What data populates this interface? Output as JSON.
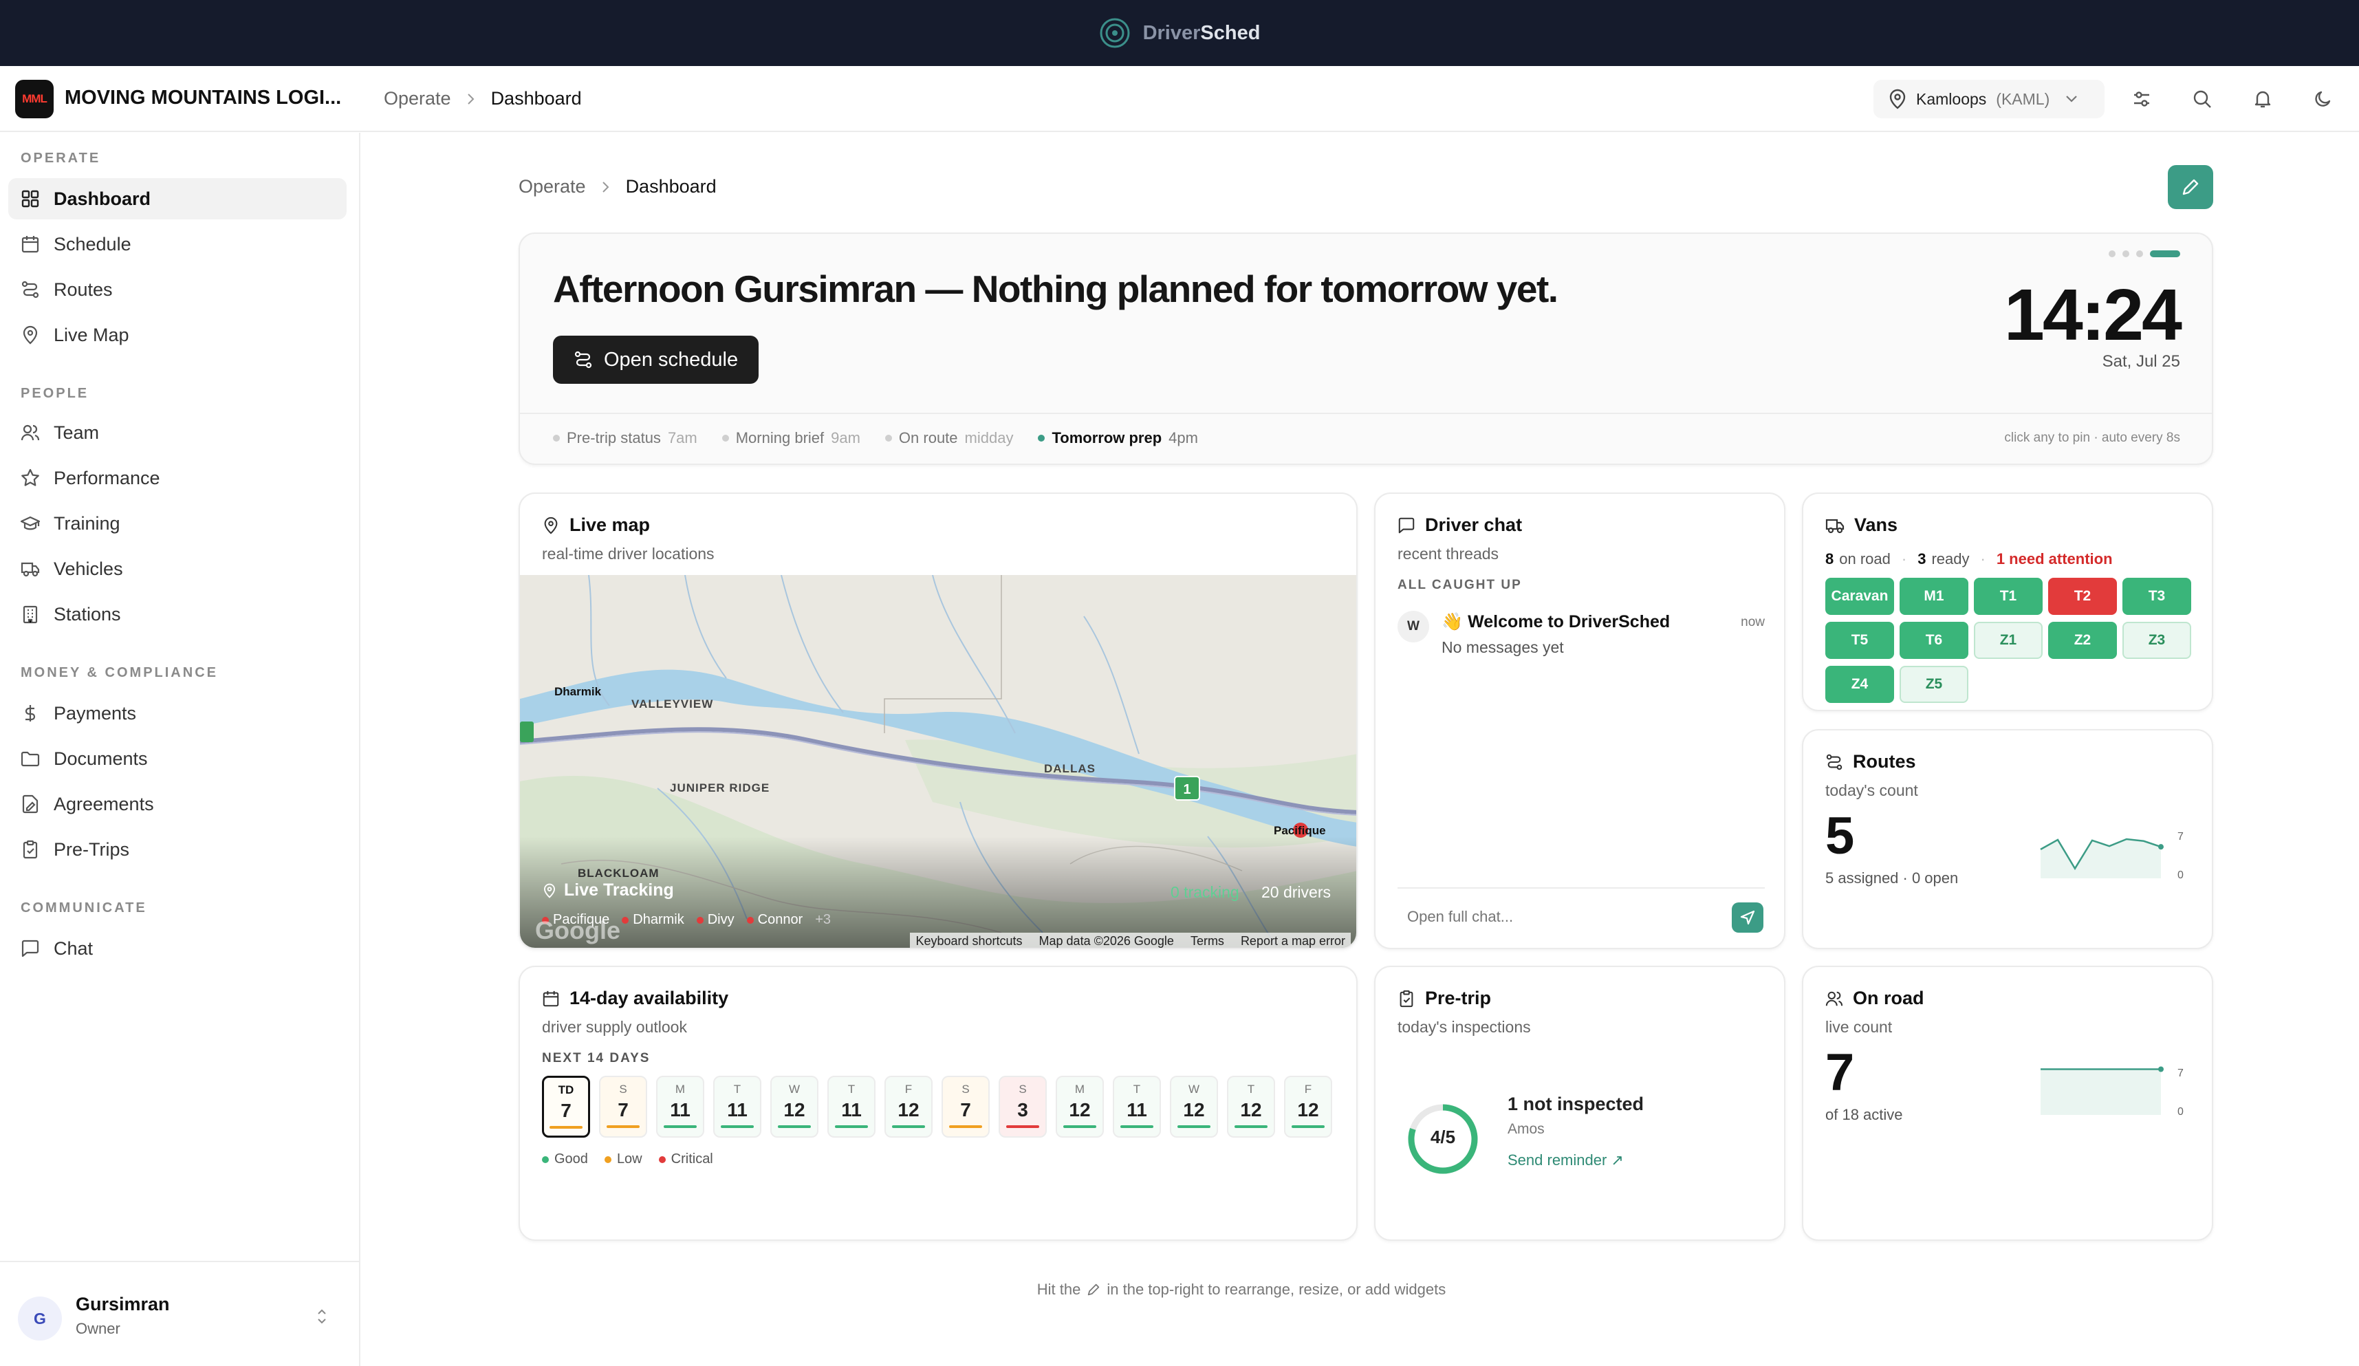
{
  "topbar": {
    "brand_first": "Driver",
    "brand_second": "Sched"
  },
  "header": {
    "org_logo": "MML",
    "org_name": "MOVING MOUNTAINS LOGI...",
    "breadcrumb": [
      "Operate",
      "Dashboard"
    ],
    "location": "Kamloops",
    "location_code": "(KAML)"
  },
  "sidebar": {
    "sections": [
      {
        "title": "OPERATE",
        "items": [
          {
            "label": "Dashboard",
            "icon": "grid-icon"
          },
          {
            "label": "Schedule",
            "icon": "calendar-icon"
          },
          {
            "label": "Routes",
            "icon": "route-icon"
          },
          {
            "label": "Live Map",
            "icon": "map-pin-icon"
          }
        ]
      },
      {
        "title": "PEOPLE",
        "items": [
          {
            "label": "Team",
            "icon": "users-icon"
          },
          {
            "label": "Performance",
            "icon": "star-icon"
          },
          {
            "label": "Training",
            "icon": "graduation-cap-icon"
          },
          {
            "label": "Vehicles",
            "icon": "truck-icon"
          },
          {
            "label": "Stations",
            "icon": "building-icon"
          }
        ]
      },
      {
        "title": "MONEY & COMPLIANCE",
        "items": [
          {
            "label": "Payments",
            "icon": "dollar-icon"
          },
          {
            "label": "Documents",
            "icon": "folder-icon"
          },
          {
            "label": "Agreements",
            "icon": "file-signature-icon"
          },
          {
            "label": "Pre-Trips",
            "icon": "clipboard-check-icon"
          }
        ]
      },
      {
        "title": "COMMUNICATE",
        "items": [
          {
            "label": "Chat",
            "icon": "message-icon"
          }
        ]
      }
    ],
    "user": {
      "initial": "G",
      "name": "Gursimran",
      "role": "Owner"
    }
  },
  "main": {
    "breadcrumb": [
      "Operate",
      "Dashboard"
    ],
    "hero": {
      "headline": "Afternoon Gursimran — Nothing planned for tomorrow yet.",
      "button": "Open schedule",
      "time": "14:24",
      "date": "Sat, Jul 25",
      "phases": [
        {
          "label": "Pre-trip status",
          "time": "7am",
          "active": false
        },
        {
          "label": "Morning brief",
          "time": "9am",
          "active": false
        },
        {
          "label": "On route",
          "time": "midday",
          "active": false
        },
        {
          "label": "Tomorrow prep",
          "time": "4pm",
          "active": true
        }
      ],
      "hint": "click any to pin · auto every 8s"
    },
    "live_map": {
      "title": "Live map",
      "subtitle": "real-time driver locations",
      "places": [
        "VALLEYVIEW",
        "JUNIPER RIDGE",
        "DALLAS",
        "BLACKLOAM"
      ],
      "markers": [
        "Dharmik",
        "Pacifique"
      ],
      "overlay_title": "Live Tracking",
      "tracking": "0 tracking",
      "drivers": "20 drivers",
      "legend": [
        "Pacifique",
        "Dharmik",
        "Divy",
        "Connor"
      ],
      "legend_more": "+3",
      "footer": [
        "Keyboard shortcuts",
        "Map data ©2026 Google",
        "Terms",
        "Report a map error"
      ],
      "google": "Google"
    },
    "chat": {
      "title": "Driver chat",
      "subtitle": "recent threads",
      "status": "ALL CAUGHT UP",
      "thread_avatar": "W",
      "thread_title": "👋 Welcome to DriverSched",
      "thread_time": "now",
      "thread_preview": "No messages yet",
      "input_placeholder": "Open full chat..."
    },
    "vans": {
      "title": "Vans",
      "on_road_n": "8",
      "on_road_l": "on road",
      "ready_n": "3",
      "ready_l": "ready",
      "attention": "1 need attention",
      "tiles": [
        {
          "id": "Caravan",
          "state": "road"
        },
        {
          "id": "M1",
          "state": "road"
        },
        {
          "id": "T1",
          "state": "road"
        },
        {
          "id": "T2",
          "state": "attention"
        },
        {
          "id": "T3",
          "state": "road"
        },
        {
          "id": "T5",
          "state": "road"
        },
        {
          "id": "T6",
          "state": "road"
        },
        {
          "id": "Z1",
          "state": "ready"
        },
        {
          "id": "Z2",
          "state": "road"
        },
        {
          "id": "Z3",
          "state": "ready"
        },
        {
          "id": "Z4",
          "state": "road"
        },
        {
          "id": "Z5",
          "state": "ready"
        }
      ]
    },
    "routes": {
      "title": "Routes",
      "subtitle": "today's count",
      "value": "5",
      "detail": "5 assigned · 0 open",
      "spark_max": "7",
      "spark_min": "0",
      "spark": [
        4,
        5.5,
        1,
        5.4,
        4.5,
        5.6,
        5.3,
        4.4
      ]
    },
    "availability": {
      "title": "14-day availability",
      "subtitle": "driver supply outlook",
      "label": "NEXT 14 DAYS",
      "days": [
        {
          "d": "TD",
          "v": "7",
          "s": "low"
        },
        {
          "d": "S",
          "v": "7",
          "s": "low"
        },
        {
          "d": "M",
          "v": "11",
          "s": "good"
        },
        {
          "d": "T",
          "v": "11",
          "s": "good"
        },
        {
          "d": "W",
          "v": "12",
          "s": "good"
        },
        {
          "d": "T",
          "v": "11",
          "s": "good"
        },
        {
          "d": "F",
          "v": "12",
          "s": "good"
        },
        {
          "d": "S",
          "v": "7",
          "s": "low"
        },
        {
          "d": "S",
          "v": "3",
          "s": "critical"
        },
        {
          "d": "M",
          "v": "12",
          "s": "good"
        },
        {
          "d": "T",
          "v": "11",
          "s": "good"
        },
        {
          "d": "W",
          "v": "12",
          "s": "good"
        },
        {
          "d": "T",
          "v": "12",
          "s": "good"
        },
        {
          "d": "F",
          "v": "12",
          "s": "good"
        }
      ],
      "legend": [
        "Good",
        "Low",
        "Critical"
      ],
      "colors": {
        "good": "#3ab57a",
        "low": "#f0a020",
        "critical": "#e23b3b"
      }
    },
    "pretrip": {
      "title": "Pre-trip",
      "subtitle": "today's inspections",
      "ring_label": "4/5",
      "ring_fraction": 0.8,
      "status": "1 not inspected",
      "name": "Amos",
      "action": "Send reminder ↗"
    },
    "onroad": {
      "title": "On road",
      "subtitle": "live count",
      "value": "7",
      "detail": "of 18 active",
      "spark_max": "7",
      "spark_min": "0",
      "spark": [
        7,
        7,
        7,
        7,
        7,
        7,
        7
      ]
    },
    "footer_pre": "Hit the",
    "footer_post": "in the top-right to rearrange, resize, or add widgets"
  }
}
